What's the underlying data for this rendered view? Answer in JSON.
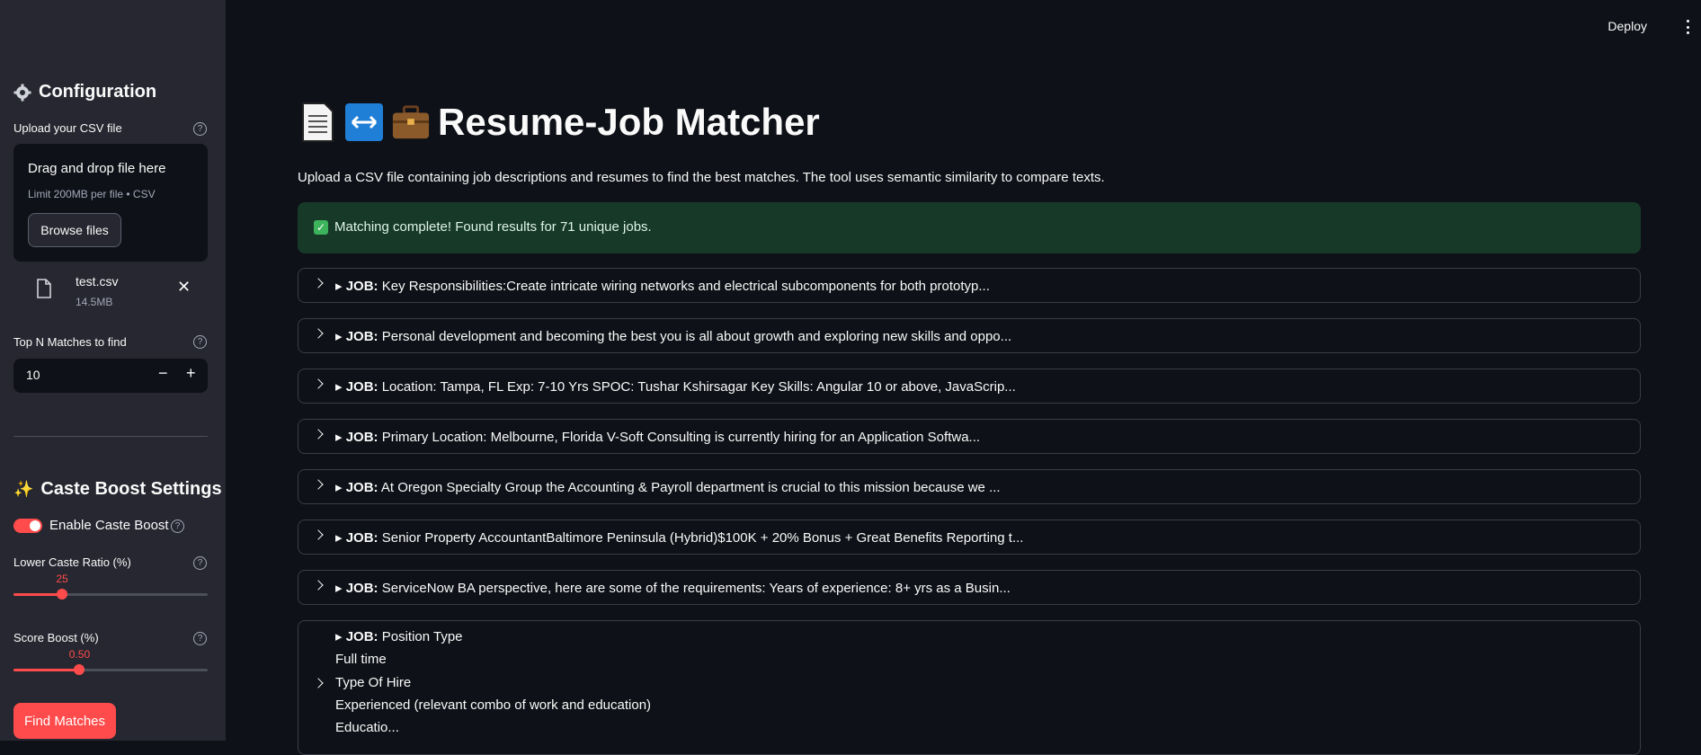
{
  "header": {
    "deploy_label": "Deploy"
  },
  "sidebar": {
    "config_title": "Configuration",
    "upload_label": "Upload your CSV file",
    "dropzone_title": "Drag and drop file here",
    "dropzone_sub": "Limit 200MB per file • CSV",
    "browse_label": "Browse files",
    "file": {
      "name": "test.csv",
      "size": "14.5MB"
    },
    "topn_label": "Top N Matches to find",
    "topn_value": "10",
    "caste_title": "Caste Boost Settings",
    "enable_label": "Enable Caste Boost",
    "enable_on": true,
    "lower_ratio_label": "Lower Caste Ratio (%)",
    "lower_ratio_value": "25",
    "lower_ratio_fraction": 0.25,
    "score_boost_label": "Score Boost (%)",
    "score_boost_value": "0.50",
    "score_boost_fraction": 0.34,
    "find_label": "Find Matches"
  },
  "main": {
    "title": "Resume-Job Matcher",
    "intro": "Upload a CSV file containing job descriptions and resumes to find the best matches. The tool uses semantic similarity to compare texts.",
    "success": "Matching complete! Found results for 71 unique jobs.",
    "job_prefix": "JOB:",
    "jobs": [
      "Key Responsibilities:Create intricate wiring networks and electrical subcomponents for both prototyp...",
      "Personal development and becoming the best you is all about growth and exploring new skills and oppo...",
      "Location: Tampa, FL Exp: 7-10 Yrs SPOC: Tushar Kshirsagar Key Skills: Angular 10 or above, JavaScrip...",
      "Primary Location: Melbourne, Florida V-Soft Consulting is currently hiring for an Application Softwa...",
      "At Oregon Specialty Group the Accounting & Payroll department is crucial to this mission because we ...",
      "Senior Property AccountantBaltimore Peninsula (Hybrid)$100K + 20% Bonus + Great Benefits Reporting t...",
      "ServiceNow BA perspective, here are some of the requirements: Years of experience: 8+ yrs as a Busin..."
    ],
    "last_job": {
      "title": "Position Type",
      "line1": "Full time",
      "line2": "Type Of Hire",
      "line3": "Experienced (relevant combo of work and education)",
      "line4": "Educatio..."
    }
  }
}
